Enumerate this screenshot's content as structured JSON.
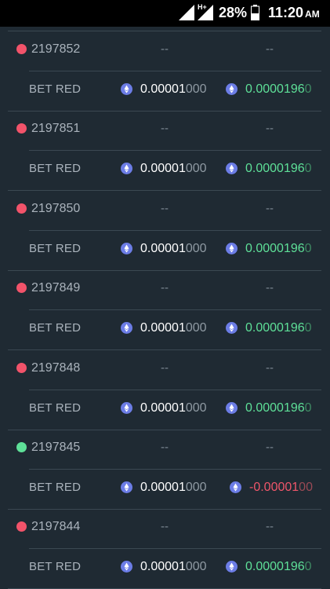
{
  "status_bar": {
    "network_label": "H+",
    "battery": "28%",
    "time": "11:20",
    "ampm": "AM"
  },
  "colors": {
    "red_dot": "#f2536a",
    "green_dot": "#5ee098",
    "coin": "#6c7de6",
    "positive": "#5ee098",
    "negative": "#f0566a"
  },
  "rounds": [
    {
      "id": "2197852",
      "dot": "red",
      "dash1": "--",
      "dash2": "--",
      "bet_label": "BET RED",
      "bet_strong": "0.00001",
      "bet_faint": "000",
      "result_strong": "0.0000196",
      "result_faint": "0",
      "result_sign": "pos"
    },
    {
      "id": "2197851",
      "dot": "red",
      "dash1": "--",
      "dash2": "--",
      "bet_label": "BET RED",
      "bet_strong": "0.00001",
      "bet_faint": "000",
      "result_strong": "0.0000196",
      "result_faint": "0",
      "result_sign": "pos"
    },
    {
      "id": "2197850",
      "dot": "red",
      "dash1": "--",
      "dash2": "--",
      "bet_label": "BET RED",
      "bet_strong": "0.00001",
      "bet_faint": "000",
      "result_strong": "0.0000196",
      "result_faint": "0",
      "result_sign": "pos"
    },
    {
      "id": "2197849",
      "dot": "red",
      "dash1": "--",
      "dash2": "--",
      "bet_label": "BET RED",
      "bet_strong": "0.00001",
      "bet_faint": "000",
      "result_strong": "0.0000196",
      "result_faint": "0",
      "result_sign": "pos"
    },
    {
      "id": "2197848",
      "dot": "red",
      "dash1": "--",
      "dash2": "--",
      "bet_label": "BET RED",
      "bet_strong": "0.00001",
      "bet_faint": "000",
      "result_strong": "0.0000196",
      "result_faint": "0",
      "result_sign": "pos"
    },
    {
      "id": "2197845",
      "dot": "green",
      "dash1": "--",
      "dash2": "--",
      "bet_label": "BET RED",
      "bet_strong": "0.00001",
      "bet_faint": "000",
      "result_strong": "-0.00001",
      "result_faint": "00",
      "result_sign": "neg"
    },
    {
      "id": "2197844",
      "dot": "red",
      "dash1": "--",
      "dash2": "--",
      "bet_label": "BET RED",
      "bet_strong": "0.00001",
      "bet_faint": "000",
      "result_strong": "0.0000196",
      "result_faint": "0",
      "result_sign": "pos"
    }
  ]
}
